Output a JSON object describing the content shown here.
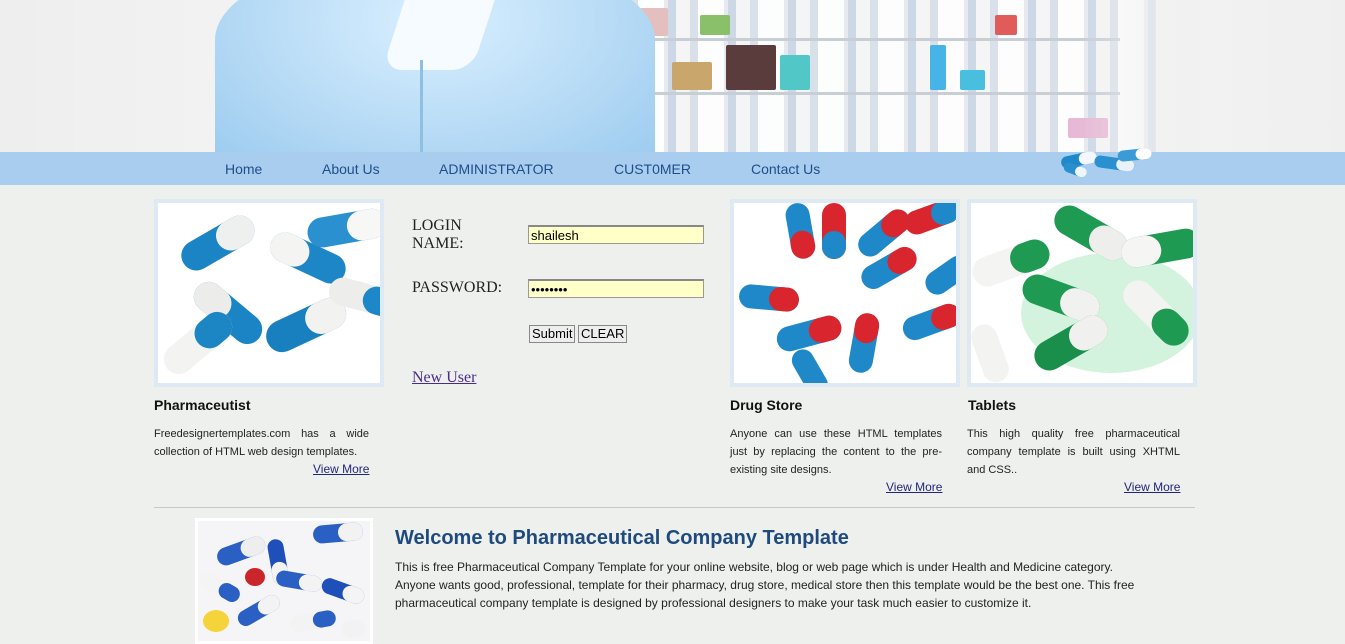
{
  "nav": {
    "items": [
      "Home",
      "About Us",
      "ADMINISTRATOR",
      "CUST0MER",
      "Contact Us"
    ]
  },
  "login": {
    "name_label_line1": "LOGIN",
    "name_label_line2": "NAME:",
    "password_label": "PASSWORD:",
    "name_value": "shailesh",
    "password_value": "••••••••",
    "submit_label": "Submit",
    "clear_label": "CLEAR",
    "new_user_label": "New User"
  },
  "features": [
    {
      "title": "Pharmaceutist",
      "text": "Freedesignertemplates.com has a wide collection of HTML web design templates.",
      "link": "View More"
    },
    {
      "title": "Drug Store",
      "text": "Anyone can use these HTML templates just by replacing the content to the pre-existing site designs.",
      "link": "View More"
    },
    {
      "title": "Tablets",
      "text": "This high quality free pharmaceutical company template is built using XHTML and CSS..",
      "link": "View More"
    }
  ],
  "welcome": {
    "title": "Welcome to Pharmaceutical Company Template",
    "text": "This is free Pharmaceutical Company Template for your online website, blog or web page which is under Health and Medicine category. Anyone wants good, professional, template for their pharmacy, drug store, medical store then this template would be the best one. This free pharmaceutical company template is designed by professional designers to make your task much easier to customize it."
  },
  "colors": {
    "nav_bar": "#a9cdee",
    "nav_text": "#1f4e8a",
    "input_bg": "#ffffc8",
    "welcome_title": "#1f4a7d",
    "capsule_blue": "#1f88c9",
    "capsule_red": "#d9262e",
    "capsule_green": "#1e9a52"
  },
  "images": {
    "header": "pharmacist-shelves-banner",
    "nav_decoration": "blue-capsules-icon",
    "pharmaceutist": "blue-white-capsules-image",
    "drug_store": "red-blue-capsules-image",
    "tablets": "green-white-capsules-image",
    "welcome": "assorted-pills-image"
  }
}
